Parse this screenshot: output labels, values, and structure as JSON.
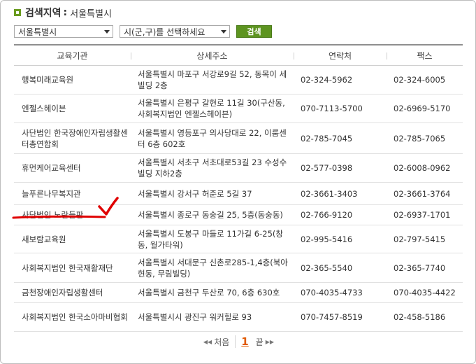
{
  "header": {
    "title": "검색지역",
    "separator": ":",
    "region": "서울특별시"
  },
  "controls": {
    "city_value": "서울특별시",
    "district_value": "시(군,구)를 선택하세요",
    "search_label": "검색"
  },
  "table": {
    "columns": [
      "교육기관",
      "상세주소",
      "연락처",
      "팩스"
    ],
    "rows": [
      {
        "name": "행복미래교육원",
        "address": "서울특별시 마포구 서강로9길 52, 동목이 세빌딩 2층",
        "phone": "02-324-5962",
        "fax": "02-324-6005"
      },
      {
        "name": "엔젤스헤이븐",
        "address": "서울특별시 은평구 갈현로 11길 30(구산동, 사회복지법인 엔젤스헤이븐)",
        "phone": "070-7113-5700",
        "fax": "02-6969-5170"
      },
      {
        "name": "사단법인 한국장애인자립생활센터총연합회",
        "address": "서울특별시 영등포구 의사당대로 22, 이룸센터 6층 602호",
        "phone": "02-785-7045",
        "fax": "02-785-7065"
      },
      {
        "name": "휴먼케어교육센터",
        "address": "서울특별시 서초구 서초대로53길 23 수성수빌딩 지하2층",
        "phone": "02-577-0398",
        "fax": "02-6008-0962"
      },
      {
        "name": "늘푸른나무복지관",
        "address": "서울특별시 강서구 허준로 5길 37",
        "phone": "02-3661-3403",
        "fax": "02-3661-3764"
      },
      {
        "name": "사단법인 노란들판",
        "address": "서울특별시 종로구 동숭길 25, 5층(동숭동)",
        "phone": "02-766-9120",
        "fax": "02-6937-1701"
      },
      {
        "name": "새보람교육원",
        "address": "서울특별시 도봉구 마들로 11가길 6-25(창동, 월가타워)",
        "phone": "02-995-5416",
        "fax": "02-797-5415"
      },
      {
        "name": "사회복지법인 한국재활재단",
        "address": "서울특별시 서대문구 신촌로285-1,4층(북아현동, 무림빌딩)",
        "phone": "02-365-5540",
        "fax": "02-365-7740"
      },
      {
        "name": "금천장애인자립생활센터",
        "address": "서울특별시 금천구 두산로 70, 6층 630호",
        "phone": "070-4035-4733",
        "fax": "070-4035-4422"
      },
      {
        "name": "사회복지법인 한국소아마비협회",
        "address": "서울특별시시 광진구 워커힐로 93",
        "phone": "070-7457-8519",
        "fax": "02-458-5186"
      }
    ]
  },
  "pagination": {
    "first_label": "처음",
    "current_page": "1",
    "last_label": "끝"
  },
  "annotation": {
    "color": "#e00000",
    "marked_row": "사단법인 노란들판"
  }
}
